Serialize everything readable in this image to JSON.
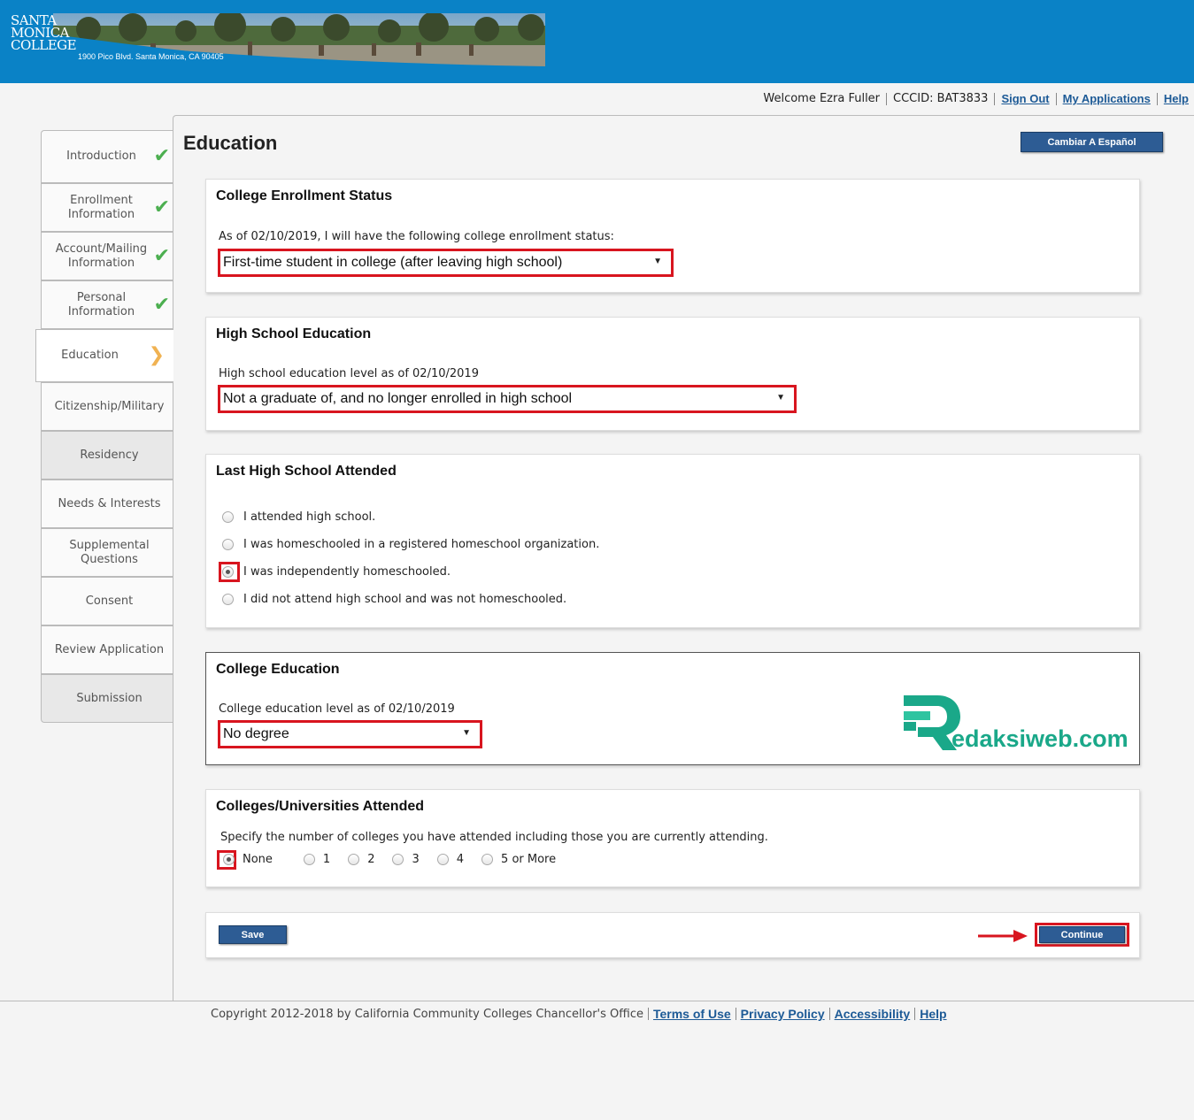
{
  "header": {
    "logo_lines": [
      "SANTA",
      "MONICA",
      "COLLEGE"
    ],
    "address": "1900 Pico Blvd. Santa Monica, CA 90405"
  },
  "userbar": {
    "welcome": "Welcome Ezra Fuller",
    "cccid": "CCCID: BAT3833",
    "sign_out": "Sign Out",
    "my_applications": "My Applications",
    "help": "Help"
  },
  "sidebar": {
    "items": [
      {
        "label": "Introduction",
        "status": "complete"
      },
      {
        "label": "Enrollment Information",
        "status": "complete"
      },
      {
        "label": "Account/Mailing Information",
        "status": "complete"
      },
      {
        "label": "Personal Information",
        "status": "complete"
      },
      {
        "label": "Education",
        "status": "current"
      },
      {
        "label": "Citizenship/Military",
        "status": "none"
      },
      {
        "label": "Residency",
        "status": "none"
      },
      {
        "label": "Needs & Interests",
        "status": "none"
      },
      {
        "label": "Supplemental Questions",
        "status": "none"
      },
      {
        "label": "Consent",
        "status": "none"
      },
      {
        "label": "Review Application",
        "status": "none"
      },
      {
        "label": "Submission",
        "status": "none"
      }
    ]
  },
  "main": {
    "title": "Education",
    "lang_button": "Cambiar A Español",
    "enrollment": {
      "heading": "College Enrollment Status",
      "question": "As of 02/10/2019, I will have the following college enrollment status:",
      "selected": "First-time student in college (after leaving high school)"
    },
    "high_school": {
      "heading": "High School Education",
      "question": "High school education level as of 02/10/2019",
      "selected": "Not a graduate of, and no longer enrolled in high school"
    },
    "last_hs": {
      "heading": "Last High School Attended",
      "options": [
        {
          "label": "I attended high school.",
          "checked": false
        },
        {
          "label": "I was homeschooled in a registered homeschool organization.",
          "checked": false
        },
        {
          "label": "I was independently homeschooled.",
          "checked": true
        },
        {
          "label": "I did not attend high school and was not homeschooled.",
          "checked": false
        }
      ]
    },
    "college_ed": {
      "heading": "College Education",
      "question": "College education level as of 02/10/2019",
      "selected": "No degree"
    },
    "colleges_attended": {
      "heading": "Colleges/Universities Attended",
      "question": "Specify the number of colleges you have attended including those you are currently attending.",
      "options": [
        "None",
        "1",
        "2",
        "3",
        "4",
        "5 or More"
      ],
      "selected": "None"
    },
    "save_label": "Save",
    "continue_label": "Continue"
  },
  "watermark": {
    "text": "edaksiweb.com",
    "letter": "R"
  },
  "footer": {
    "copyright": "Copyright 2012-2018 by California Community Colleges Chancellor's Office",
    "terms": "Terms of Use",
    "privacy": "Privacy Policy",
    "accessibility": "Accessibility",
    "help": "Help"
  },
  "colors": {
    "header_blue": "#0a82c6",
    "button_blue": "#2d5c94",
    "highlight_red": "#d8151f",
    "check_green": "#4caf50",
    "arrow_orange": "#f0b252",
    "watermark_green": "#1aa889"
  }
}
